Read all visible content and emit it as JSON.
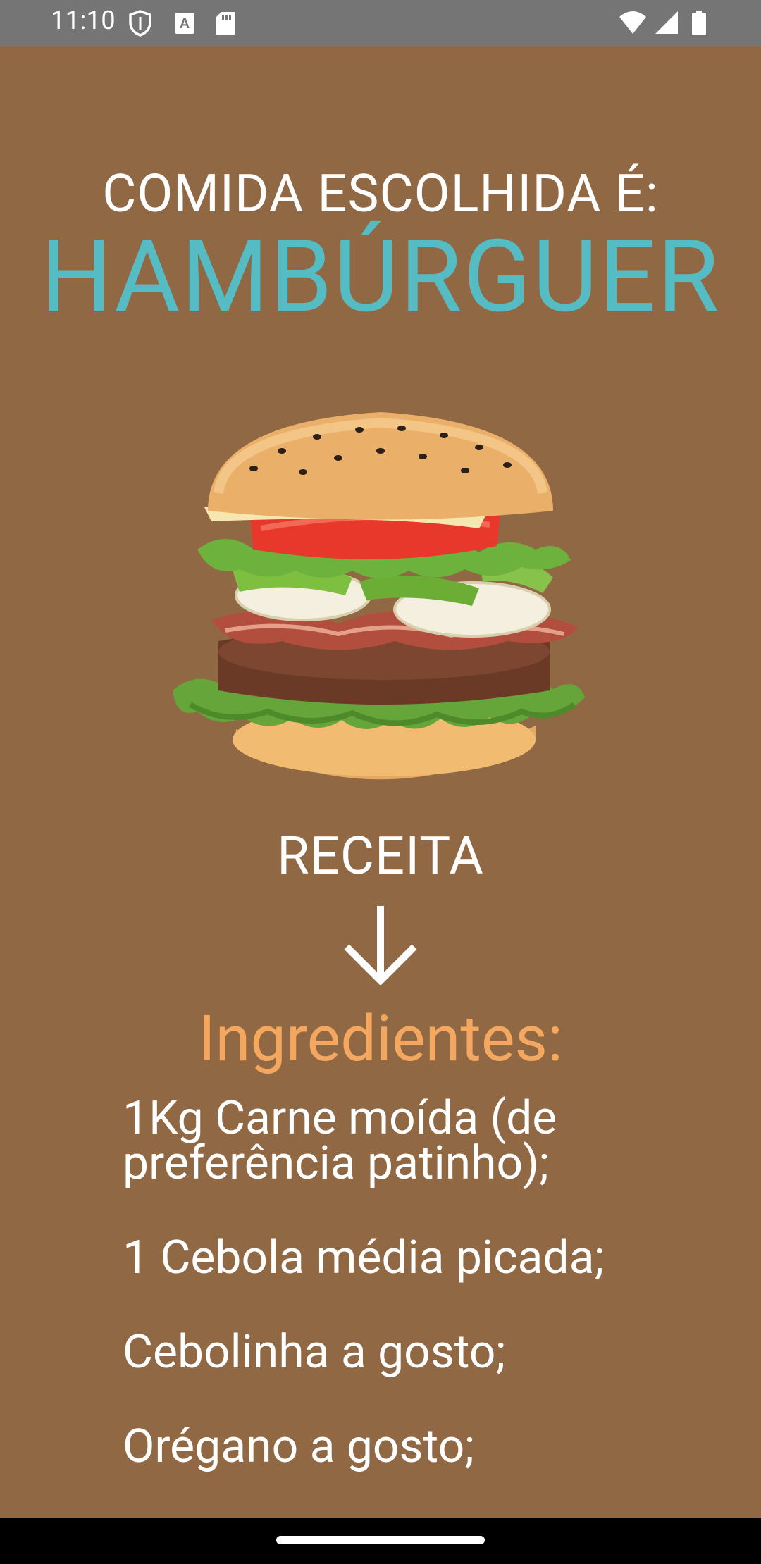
{
  "status_bar": {
    "time": "11:10",
    "icons": [
      "shield-icon",
      "text-a-icon",
      "sd-card-icon",
      "wifi-icon",
      "signal-icon",
      "battery-icon"
    ]
  },
  "header": {
    "prefix": "COMIDA ESCOLHIDA É:",
    "food_name": "HAMBÚRGUER"
  },
  "recipe": {
    "label": "RECEITA",
    "arrow_icon": "arrow-down-icon"
  },
  "ingredients": {
    "title": "Ingredientes:",
    "items": [
      "1Kg Carne moída (de preferência patinho);",
      "1 Cebola média picada;",
      "Cebolinha a gosto;",
      "Orégano a gosto;"
    ]
  },
  "colors": {
    "background": "#916844",
    "food_name": "#56bcc4",
    "ingredients_title": "#f4a75f",
    "status_bar": "#757575"
  }
}
